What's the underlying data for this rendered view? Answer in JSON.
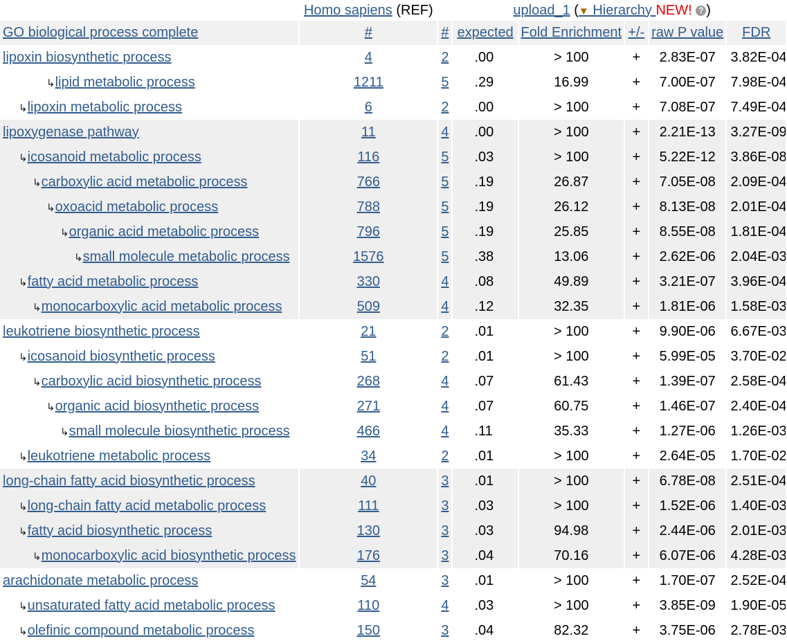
{
  "header": {
    "ref_species": "Homo sapiens",
    "ref_suffix": " (REF)",
    "upload_label": "upload_1",
    "paren_open": " (",
    "hierarchy_label": " Hierarchy ",
    "new_label": "NEW!",
    "paren_close": ")",
    "help_glyph": "?",
    "columns": {
      "name": "GO biological process complete",
      "ref_count": "#",
      "count": "#",
      "expected": "expected",
      "fold": "Fold Enrichment",
      "direction": "+/-",
      "pvalue": "raw P value",
      "fdr": "FDR"
    }
  },
  "rows": [
    {
      "indent": 0,
      "label": "lipoxin biosynthetic process",
      "ref": "4",
      "count": "2",
      "expected": ".00",
      "fold": "> 100",
      "sign": "+",
      "p": "2.83E-07",
      "fdr": "3.82E-04",
      "shade": false
    },
    {
      "indent": 3,
      "label": "lipid metabolic process",
      "ref": "1211",
      "count": "5",
      "expected": ".29",
      "fold": "16.99",
      "sign": "+",
      "p": "7.00E-07",
      "fdr": "7.98E-04",
      "shade": false
    },
    {
      "indent": 1,
      "label": "lipoxin metabolic process",
      "ref": "6",
      "count": "2",
      "expected": ".00",
      "fold": "> 100",
      "sign": "+",
      "p": "7.08E-07",
      "fdr": "7.49E-04",
      "shade": false
    },
    {
      "indent": 0,
      "label": "lipoxygenase pathway",
      "ref": "11",
      "count": "4",
      "expected": ".00",
      "fold": "> 100",
      "sign": "+",
      "p": "2.21E-13",
      "fdr": "3.27E-09",
      "shade": true
    },
    {
      "indent": 1,
      "label": "icosanoid metabolic process",
      "ref": "116",
      "count": "5",
      "expected": ".03",
      "fold": "> 100",
      "sign": "+",
      "p": "5.22E-12",
      "fdr": "3.86E-08",
      "shade": true
    },
    {
      "indent": 2,
      "label": "carboxylic acid metabolic process",
      "ref": "766",
      "count": "5",
      "expected": ".19",
      "fold": "26.87",
      "sign": "+",
      "p": "7.05E-08",
      "fdr": "2.09E-04",
      "shade": true
    },
    {
      "indent": 3,
      "label": "oxoacid metabolic process",
      "ref": "788",
      "count": "5",
      "expected": ".19",
      "fold": "26.12",
      "sign": "+",
      "p": "8.13E-08",
      "fdr": "2.01E-04",
      "shade": true
    },
    {
      "indent": 4,
      "label": "organic acid metabolic process",
      "ref": "796",
      "count": "5",
      "expected": ".19",
      "fold": "25.85",
      "sign": "+",
      "p": "8.55E-08",
      "fdr": "1.81E-04",
      "shade": true
    },
    {
      "indent": 5,
      "label": "small molecule metabolic process",
      "ref": "1576",
      "count": "5",
      "expected": ".38",
      "fold": "13.06",
      "sign": "+",
      "p": "2.62E-06",
      "fdr": "2.04E-03",
      "shade": true
    },
    {
      "indent": 1,
      "label": "fatty acid metabolic process",
      "ref": "330",
      "count": "4",
      "expected": ".08",
      "fold": "49.89",
      "sign": "+",
      "p": "3.21E-07",
      "fdr": "3.96E-04",
      "shade": true
    },
    {
      "indent": 2,
      "label": "monocarboxylic acid metabolic process",
      "ref": "509",
      "count": "4",
      "expected": ".12",
      "fold": "32.35",
      "sign": "+",
      "p": "1.81E-06",
      "fdr": "1.58E-03",
      "shade": true
    },
    {
      "indent": 0,
      "label": "leukotriene biosynthetic process",
      "ref": "21",
      "count": "2",
      "expected": ".01",
      "fold": "> 100",
      "sign": "+",
      "p": "9.90E-06",
      "fdr": "6.67E-03",
      "shade": false
    },
    {
      "indent": 1,
      "label": "icosanoid biosynthetic process",
      "ref": "51",
      "count": "2",
      "expected": ".01",
      "fold": "> 100",
      "sign": "+",
      "p": "5.99E-05",
      "fdr": "3.70E-02",
      "shade": false
    },
    {
      "indent": 2,
      "label": "carboxylic acid biosynthetic process",
      "ref": "268",
      "count": "4",
      "expected": ".07",
      "fold": "61.43",
      "sign": "+",
      "p": "1.39E-07",
      "fdr": "2.58E-04",
      "shade": false
    },
    {
      "indent": 3,
      "label": "organic acid biosynthetic process",
      "ref": "271",
      "count": "4",
      "expected": ".07",
      "fold": "60.75",
      "sign": "+",
      "p": "1.46E-07",
      "fdr": "2.40E-04",
      "shade": false
    },
    {
      "indent": 4,
      "label": "small molecule biosynthetic process",
      "ref": "466",
      "count": "4",
      "expected": ".11",
      "fold": "35.33",
      "sign": "+",
      "p": "1.27E-06",
      "fdr": "1.26E-03",
      "shade": false
    },
    {
      "indent": 1,
      "label": "leukotriene metabolic process",
      "ref": "34",
      "count": "2",
      "expected": ".01",
      "fold": "> 100",
      "sign": "+",
      "p": "2.64E-05",
      "fdr": "1.70E-02",
      "shade": false
    },
    {
      "indent": 0,
      "label": "long-chain fatty acid biosynthetic process",
      "ref": "40",
      "count": "3",
      "expected": ".01",
      "fold": "> 100",
      "sign": "+",
      "p": "6.78E-08",
      "fdr": "2.51E-04",
      "shade": true
    },
    {
      "indent": 1,
      "label": "long-chain fatty acid metabolic process",
      "ref": "111",
      "count": "3",
      "expected": ".03",
      "fold": "> 100",
      "sign": "+",
      "p": "1.52E-06",
      "fdr": "1.40E-03",
      "shade": true
    },
    {
      "indent": 1,
      "label": "fatty acid biosynthetic process",
      "ref": "130",
      "count": "3",
      "expected": ".03",
      "fold": "94.98",
      "sign": "+",
      "p": "2.44E-06",
      "fdr": "2.01E-03",
      "shade": true
    },
    {
      "indent": 2,
      "label": "monocarboxylic acid biosynthetic process",
      "ref": "176",
      "count": "3",
      "expected": ".04",
      "fold": "70.16",
      "sign": "+",
      "p": "6.07E-06",
      "fdr": "4.28E-03",
      "shade": true
    },
    {
      "indent": 0,
      "label": "arachidonate metabolic process",
      "ref": "54",
      "count": "3",
      "expected": ".01",
      "fold": "> 100",
      "sign": "+",
      "p": "1.70E-07",
      "fdr": "2.52E-04",
      "shade": false
    },
    {
      "indent": 1,
      "label": "unsaturated fatty acid metabolic process",
      "ref": "110",
      "count": "4",
      "expected": ".03",
      "fold": "> 100",
      "sign": "+",
      "p": "3.85E-09",
      "fdr": "1.90E-05",
      "shade": false
    },
    {
      "indent": 1,
      "label": "olefinic compound metabolic process",
      "ref": "150",
      "count": "3",
      "expected": ".04",
      "fold": "82.32",
      "sign": "+",
      "p": "3.75E-06",
      "fdr": "2.78E-03",
      "shade": false
    }
  ],
  "colors": {
    "link": "#315c8e",
    "shaded_row": "#efefef",
    "header_row": "#f1f1f1",
    "new_badge": "#ee0000"
  },
  "icons": {
    "child_arrow": "↳",
    "sort_triangle": "▼"
  }
}
